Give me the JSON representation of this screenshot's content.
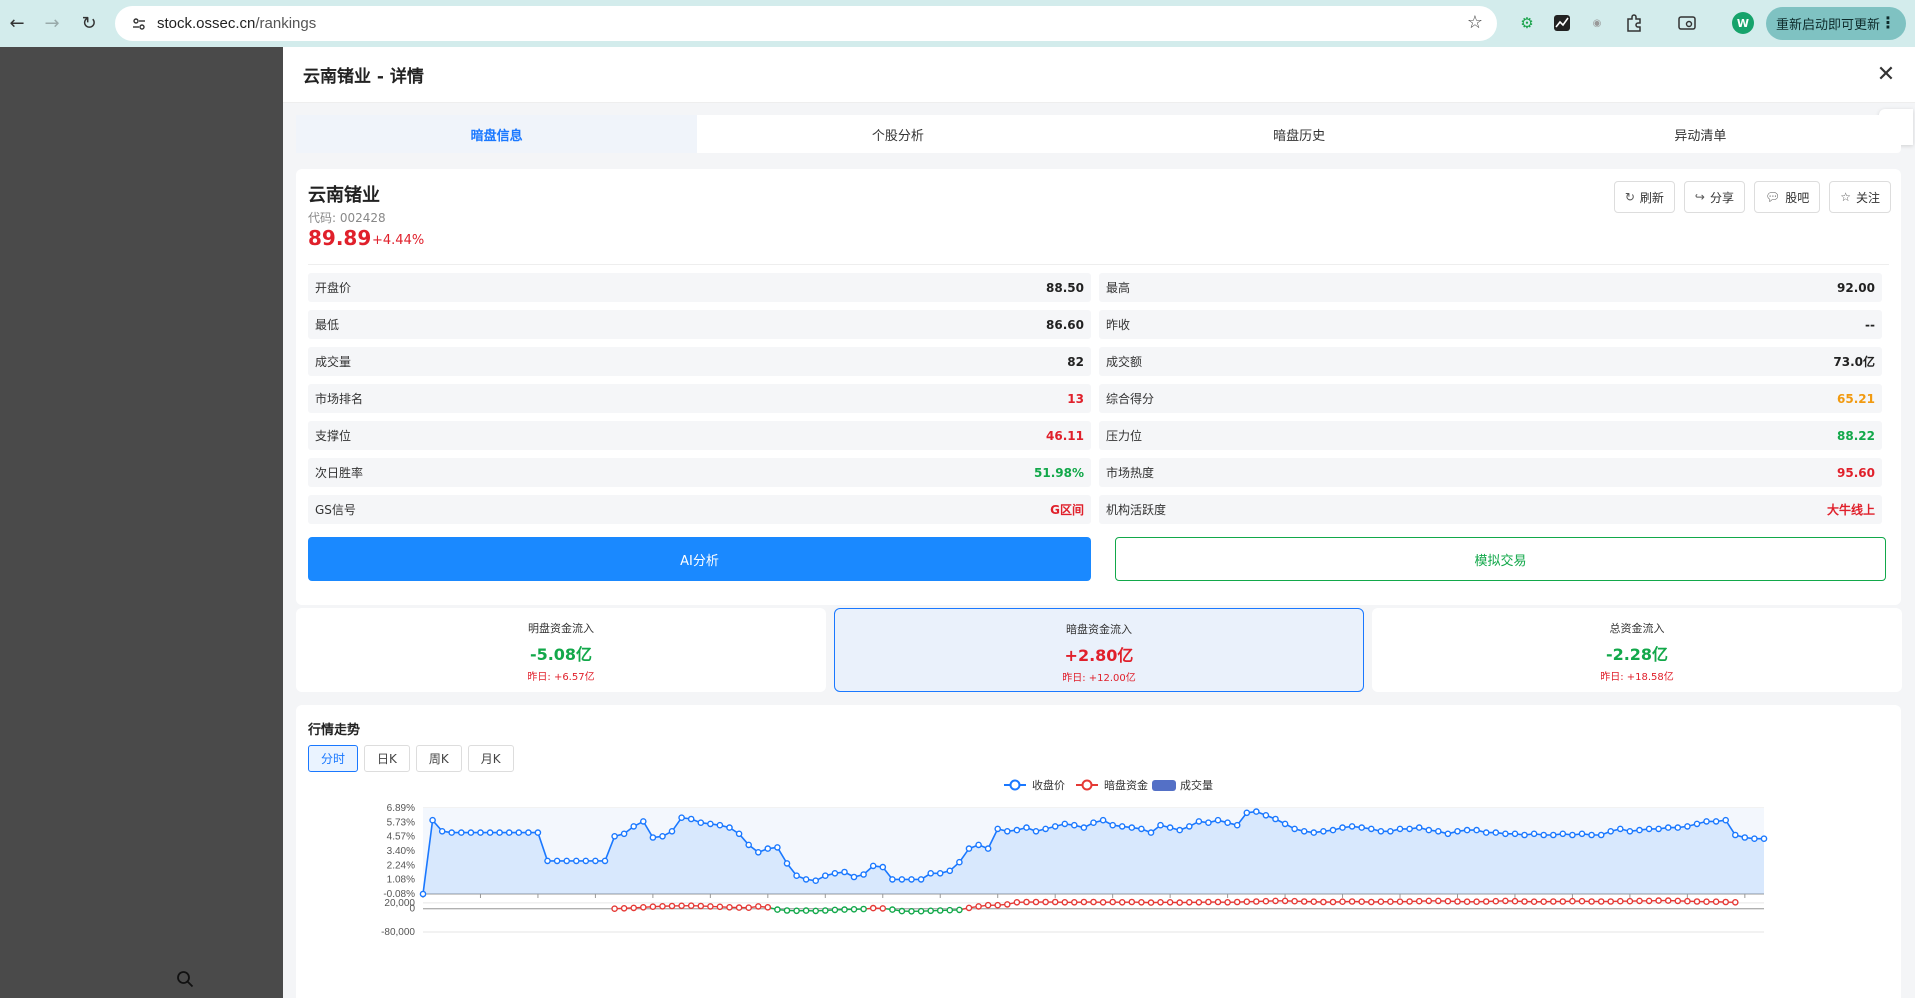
{
  "browser": {
    "url_host": "stock.ossec.cn",
    "url_path": "/rankings",
    "update_label": "重新启动即可更新",
    "profile_initial": "W"
  },
  "panel": {
    "title": "云南锗业 - 详情",
    "tabs": [
      {
        "label": "暗盘信息",
        "active": true
      },
      {
        "label": "个股分析",
        "active": false
      },
      {
        "label": "暗盘历史",
        "active": false
      },
      {
        "label": "异动清单",
        "active": false
      }
    ]
  },
  "stock": {
    "name": "云南锗业",
    "code": "代码: 002428",
    "price": "89.89",
    "change": "+4.44%"
  },
  "actions": [
    {
      "label": "刷新",
      "icon": "refresh-icon"
    },
    {
      "label": "分享",
      "icon": "share-icon"
    },
    {
      "label": "股吧",
      "icon": "chat-icon"
    },
    {
      "label": "关注",
      "icon": "star-icon"
    }
  ],
  "metrics": [
    {
      "k": "开盘价",
      "v": "88.50",
      "color": "default"
    },
    {
      "k": "最高",
      "v": "92.00",
      "color": "default"
    },
    {
      "k": "最低",
      "v": "86.60",
      "color": "default"
    },
    {
      "k": "昨收",
      "v": "--",
      "color": "default"
    },
    {
      "k": "成交量",
      "v": "82",
      "color": "default"
    },
    {
      "k": "成交额",
      "v": "73.0亿",
      "color": "default"
    },
    {
      "k": "市场排名",
      "v": "13",
      "color": "red"
    },
    {
      "k": "综合得分",
      "v": "65.21",
      "color": "orange"
    },
    {
      "k": "支撑位",
      "v": "46.11",
      "color": "red"
    },
    {
      "k": "压力位",
      "v": "88.22",
      "color": "green"
    },
    {
      "k": "次日胜率",
      "v": "51.98%",
      "color": "green"
    },
    {
      "k": "市场热度",
      "v": "95.60",
      "color": "red"
    },
    {
      "k": "GS信号",
      "v": "G区间",
      "color": "red"
    },
    {
      "k": "机构活跃度",
      "v": "大牛线上",
      "color": "red"
    }
  ],
  "buttons": {
    "ai": "AI分析",
    "sim": "模拟交易"
  },
  "flows": [
    {
      "label": "明盘资金流入",
      "value": "-5.08亿",
      "color": "green",
      "prev": "昨日: +6.57亿",
      "highlight": false
    },
    {
      "label": "暗盘资金流入",
      "value": "+2.80亿",
      "color": "red",
      "prev": "昨日: +12.00亿",
      "highlight": true
    },
    {
      "label": "总资金流入",
      "value": "-2.28亿",
      "color": "green",
      "prev": "昨日: +18.58亿",
      "highlight": false
    }
  ],
  "chart_section": {
    "title": "行情走势",
    "periods": [
      {
        "label": "分时",
        "active": true
      },
      {
        "label": "日K",
        "active": false
      },
      {
        "label": "周K",
        "active": false
      },
      {
        "label": "月K",
        "active": false
      }
    ]
  },
  "chart_data": {
    "type": "line",
    "legend": [
      "收盘价",
      "暗盘资金",
      "成交量"
    ],
    "price_axis_ticks": [
      "6.89%",
      "5.73%",
      "4.57%",
      "3.40%",
      "2.24%",
      "1.08%",
      "-0.08%"
    ],
    "fund_axis_ticks": [
      "20,000",
      "0",
      "-80,000"
    ],
    "price_pct": [
      -0.08,
      5.9,
      5.0,
      4.9,
      4.9,
      4.9,
      4.9,
      4.9,
      4.9,
      4.9,
      4.9,
      4.9,
      4.9,
      2.6,
      2.6,
      2.6,
      2.6,
      2.6,
      2.6,
      2.6,
      4.6,
      4.8,
      5.4,
      5.8,
      4.5,
      4.6,
      5.0,
      6.1,
      6.0,
      5.7,
      5.6,
      5.5,
      5.3,
      4.8,
      3.9,
      3.3,
      3.6,
      3.7,
      2.4,
      1.4,
      1.1,
      1.0,
      1.4,
      1.6,
      1.7,
      1.3,
      1.5,
      2.2,
      2.1,
      1.1,
      1.1,
      1.1,
      1.1,
      1.6,
      1.6,
      1.8,
      2.5,
      3.6,
      3.9,
      3.6,
      5.2,
      5.0,
      5.1,
      5.3,
      5.0,
      5.2,
      5.4,
      5.6,
      5.5,
      5.3,
      5.7,
      5.9,
      5.5,
      5.4,
      5.3,
      5.2,
      4.9,
      5.5,
      5.3,
      5.1,
      5.4,
      5.8,
      5.7,
      5.9,
      5.7,
      5.5,
      6.5,
      6.6,
      6.3,
      6.0,
      5.6,
      5.2,
      5.0,
      4.9,
      5.0,
      5.1,
      5.3,
      5.4,
      5.3,
      5.2,
      5.0,
      5.0,
      5.2,
      5.2,
      5.3,
      5.1,
      5.0,
      4.8,
      5.0,
      5.1,
      5.1,
      4.9,
      4.9,
      4.8,
      4.8,
      4.7,
      4.8,
      4.7,
      4.7,
      4.8,
      4.7,
      4.8,
      4.7,
      4.7,
      5.0,
      5.2,
      5.0,
      5.1,
      5.2,
      5.2,
      5.3,
      5.3,
      5.4,
      5.6,
      5.8,
      5.8,
      5.9,
      4.7,
      4.5,
      4.4,
      4.4
    ],
    "dark_fund": [
      null,
      null,
      null,
      null,
      null,
      null,
      null,
      null,
      null,
      null,
      null,
      null,
      null,
      null,
      null,
      null,
      null,
      null,
      null,
      null,
      0,
      1500,
      3000,
      5000,
      7000,
      8500,
      9500,
      10000,
      10500,
      9500,
      8000,
      6500,
      5000,
      4000,
      3500,
      8000,
      5000,
      -3000,
      -6000,
      -7000,
      -6500,
      -7500,
      -6000,
      -4000,
      -3000,
      -2000,
      -1000,
      2000,
      1000,
      -3000,
      -8000,
      -9000,
      -8500,
      -7000,
      -6000,
      -5000,
      -4000,
      3000,
      8000,
      12000,
      12000,
      15000,
      22000,
      23000,
      23000,
      23000,
      23000,
      22000,
      22000,
      23000,
      23000,
      22000,
      23000,
      22000,
      23000,
      22000,
      21000,
      22000,
      22000,
      21000,
      22000,
      22000,
      23000,
      23000,
      22000,
      23000,
      24000,
      25000,
      26000,
      27000,
      27000,
      26000,
      25000,
      24000,
      23000,
      23000,
      24000,
      25000,
      24000,
      23000,
      24000,
      24000,
      24000,
      25000,
      26000,
      27000,
      27000,
      26000,
      25000,
      24000,
      24000,
      25000,
      26000,
      27000,
      26000,
      25000,
      24000,
      24000,
      25000,
      25000,
      26000,
      26000,
      25000,
      25000,
      25000,
      26000,
      26000,
      27000,
      27000,
      28000,
      28000,
      27000,
      26000,
      25000,
      24000,
      24000,
      23000,
      22000
    ]
  }
}
